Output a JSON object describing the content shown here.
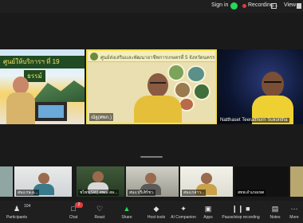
{
  "topbar": {
    "sign_in": "Sign in",
    "recording": "Recording...",
    "view": "View"
  },
  "gallery": {
    "tile1_banner": "ศูนย์ให้บริการฯ ที่ 19",
    "tile1_banner2": "ธรรม์",
    "tile2_header": "ศูนย์ส่งเสริมและพัฒนาอาชีพการเกษตรที่ 5 จังหวัดนครราชสีมา",
    "tile2_name": "ณัฐ(ศพก.)",
    "tile3_name": "Natthaset Teeratthorn Sukontha"
  },
  "strip": {
    "s2_name": "สนง.กษ.อ...",
    "s3_name": "ชไพร(SW) ศพก. สล...",
    "s4_name": "สนง.ปรีเสิร์ชว.",
    "s5_name": "สนง.กล่าว...",
    "s6_name": "สทพ.อำเภอเขต"
  },
  "toolbar": {
    "participants_label": "Participants",
    "participants_count": "104",
    "chat_label": "Chat",
    "chat_badge": "2",
    "react_label": "React",
    "share_label": "Share",
    "host_tools_label": "Host tools",
    "ai_companion_label": "AI Companion",
    "apps_label": "Apps",
    "recording_label": "Pause/stop recording",
    "notes_label": "Notes",
    "more_label": "More"
  },
  "colors": {
    "toolbar_bg": "#1f1f1f",
    "share_green": "#23d959",
    "record_red": "#e23c3c",
    "speaker_border": "#f2e14a"
  }
}
